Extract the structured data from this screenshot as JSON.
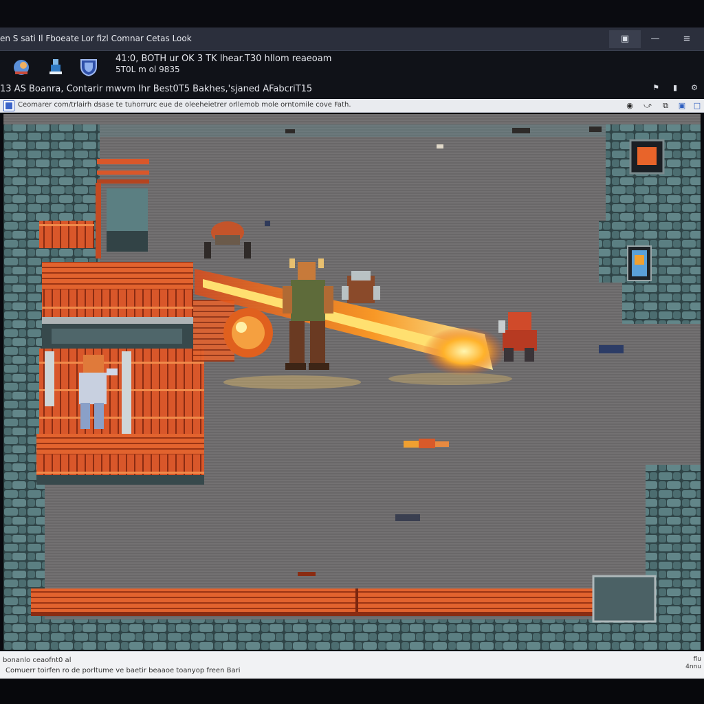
{
  "window": {
    "title": "en S sati Il Fboeate",
    "menu_title": "Lor fizl Comnar Cetas Look",
    "buttons": {
      "restore": "▣",
      "minimize": "—",
      "menu": "≡"
    }
  },
  "info": {
    "line1": "41:0, BOTH ur OK 3 TK lhear.T30 hllom reaeoam",
    "line2": "5T0L m ol 9835",
    "line3": "13 AS Boanra, Contarir mwvm Ihr Best0T5 Bakhes,'sjaned AFabcriT15",
    "icons": [
      "app-icon",
      "character-icon",
      "shield-icon"
    ]
  },
  "address": {
    "url": "Ceomarer com/trlairh dsase te tuhorrurc eue de oleeheietrer orllemob mole orntomile cove Fath."
  },
  "status": {
    "line1": "bonanlo ceaofnt0 al",
    "line2": "Comuerr toirfen ro de porltume ve baetir beaaoe toanyop freen Bari",
    "corner": "flu 4nnu"
  },
  "colors": {
    "titlebar": "#2b2f3c",
    "floor": "#6e6c6d",
    "stone": "#4f6f73",
    "wood": "#d9572a",
    "fire": "#ffb22a"
  },
  "game": {
    "scene": "dungeon-arena",
    "characters": [
      "barbarian-hero",
      "ally-warrior",
      "red-armored-knight",
      "helmeted-guard",
      "fire-demon"
    ]
  }
}
